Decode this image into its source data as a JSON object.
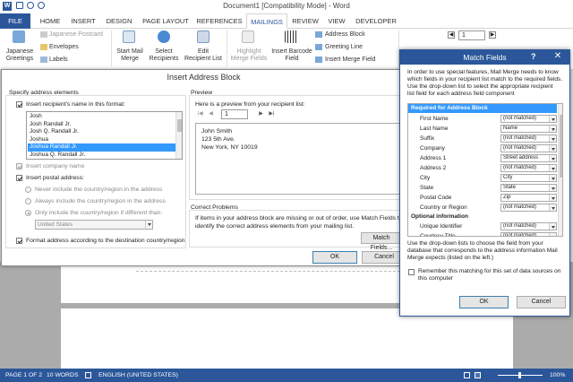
{
  "window": {
    "title": "Document1 [Compatibility Mode] - Word"
  },
  "tabs": [
    "FILE",
    "HOME",
    "INSERT",
    "DESIGN",
    "PAGE LAYOUT",
    "REFERENCES",
    "MAILINGS",
    "REVIEW",
    "VIEW",
    "DEVELOPER"
  ],
  "active_tab": "MAILINGS",
  "ribbon": {
    "japanese_greetings": "Japanese",
    "japanese_greetings2": "Greetings",
    "japanese_postcard": "Japanese Postcard",
    "envelopes": "Envelopes",
    "labels": "Labels",
    "start_mail_merge": "Start Mail",
    "start_mail_merge2": "Merge",
    "select_recipients": "Select",
    "select_recipients2": "Recipients",
    "edit_recipient_list": "Edit",
    "edit_recipient_list2": "Recipient List",
    "highlight_merge_fields": "Highlight",
    "highlight_merge_fields2": "Merge Fields",
    "address_block": "Address Block",
    "greeting_line": "Greeting Line",
    "insert_merge_field": "Insert Merge Field",
    "insert_barcode": "Insert Barcode",
    "insert_barcode2": "Field",
    "record_number": "1"
  },
  "insert_address_block": {
    "title": "Insert Address Block",
    "specify_label": "Specify address elements",
    "insert_name_label": "Insert recipient's name in this format:",
    "name_formats": [
      "Josh",
      "Josh Randall Jr.",
      "Josh Q. Randall Jr.",
      "Joshua",
      "Joshua Randall Jr.",
      "Joshua Q. Randall Jr."
    ],
    "selected_format_index": 4,
    "insert_company_label": "Insert company name",
    "insert_postal_label": "Insert postal address:",
    "never_country": "Never include the country/region in the address",
    "always_country": "Always include the country/region in the address",
    "only_country": "Only include the country/region if different than:",
    "country_value": "United States",
    "format_address_label": "Format address according to the destination country/region",
    "preview_label": "Preview",
    "preview_hint": "Here is a preview from your recipient list:",
    "preview_record": "1",
    "preview_lines": [
      "John Smith",
      "123 5th Ave.",
      "New York, NY 10019"
    ],
    "correct_problems_label": "Correct Problems",
    "correct_problems_text1": "If items in your address block are missing or out of order, use Match Fields to",
    "correct_problems_text2": "identify the correct address elements from your mailing list.",
    "match_fields_button": "Match Fields...",
    "ok_button": "OK",
    "cancel_button": "Cancel"
  },
  "match_fields": {
    "title": "Match Fields",
    "help": "?",
    "intro": [
      "In order to use special features, Mail Merge needs to know",
      "which fields in your recipient list match to the required fields.",
      "Use the drop-down list to select the appropriate recipient",
      "list field for each address field component"
    ],
    "required_header": "Required for Address Block",
    "required_fields": [
      {
        "name": "First Name",
        "value": "(not matched)"
      },
      {
        "name": "Last Name",
        "value": "Name"
      },
      {
        "name": "Suffix",
        "value": "(not matched)"
      },
      {
        "name": "Company",
        "value": "(not matched)"
      },
      {
        "name": "Address 1",
        "value": "Street address"
      },
      {
        "name": "Address 2",
        "value": "(not matched)"
      },
      {
        "name": "City",
        "value": "City"
      },
      {
        "name": "State",
        "value": "State"
      },
      {
        "name": "Postal Code",
        "value": "Zip"
      },
      {
        "name": "Country or Region",
        "value": "(not matched)"
      }
    ],
    "optional_header": "Optional information",
    "optional_fields": [
      {
        "name": "Unique Identifier",
        "value": "(not matched)"
      },
      {
        "name": "Courtesy Title",
        "value": "(not matched)"
      }
    ],
    "footer": [
      "Use the drop-down lists to choose the field from your",
      "database that corresponds to the address information Mail",
      "Merge expects (listed on the left.)"
    ],
    "remember": [
      "Remember this matching for this set of data sources on",
      "this computer"
    ],
    "ok_button": "OK",
    "cancel_button": "Cancel"
  },
  "status": {
    "page": "PAGE 1 OF 2",
    "words": "10 WORDS",
    "language": "ENGLISH (UNITED STATES)",
    "zoom": "100%"
  },
  "colors": {
    "accent": "#2b579a",
    "selection": "#3399ff"
  }
}
